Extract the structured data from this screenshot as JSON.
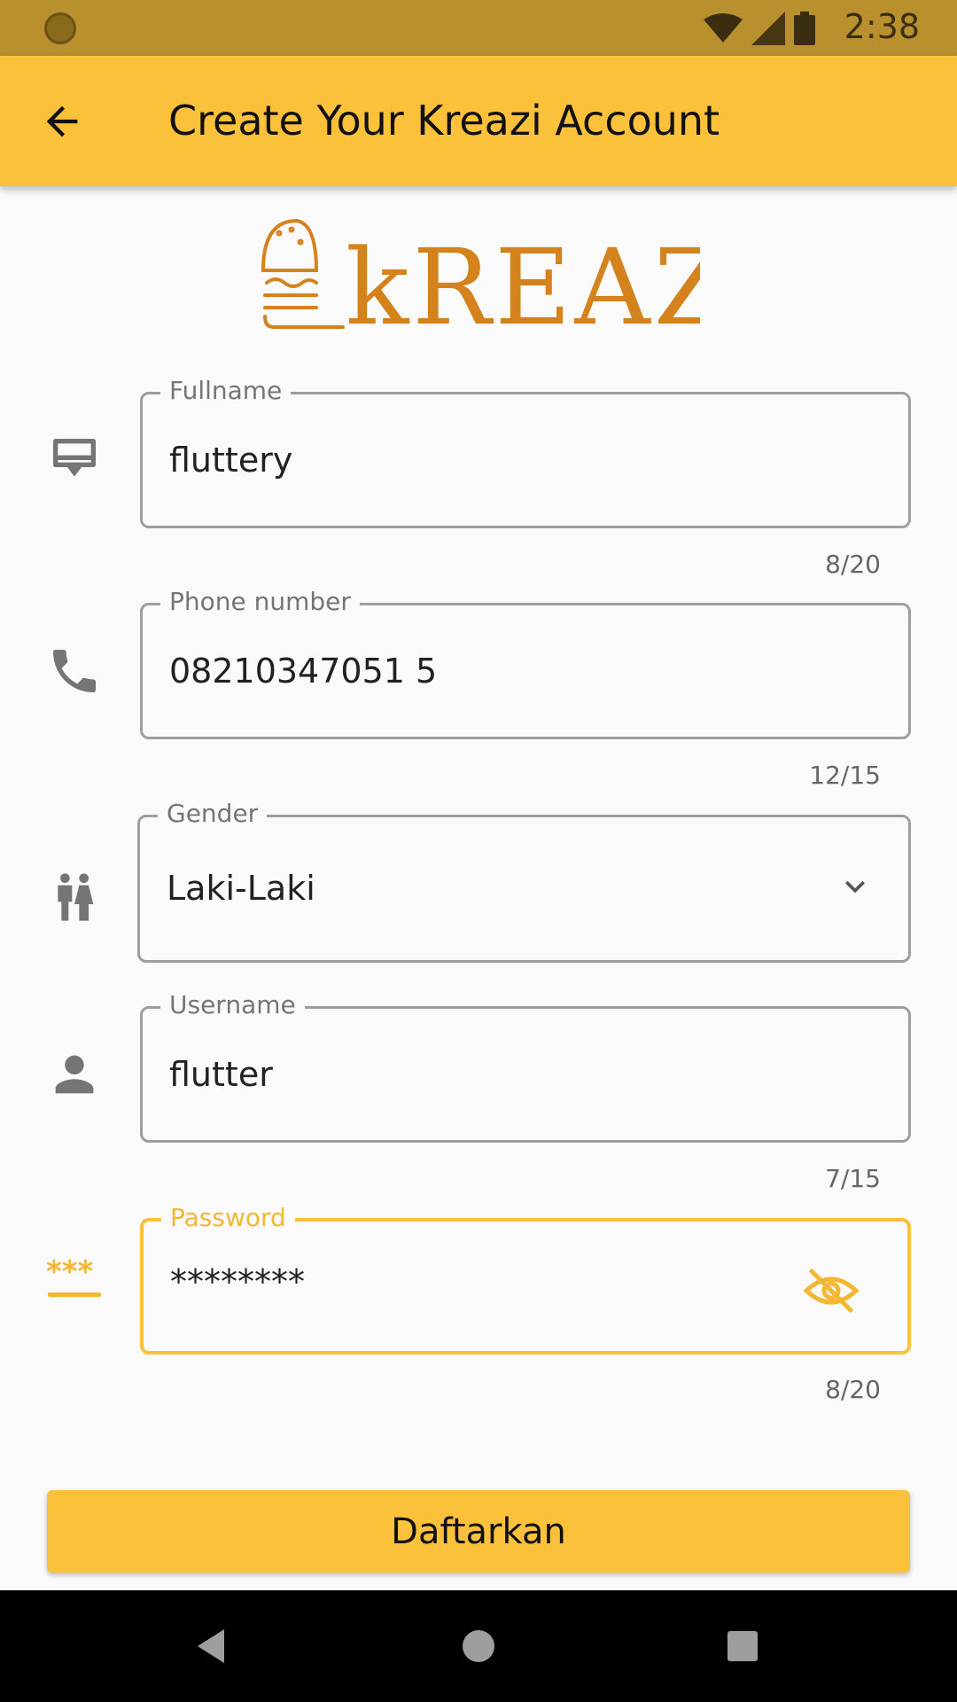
{
  "status_bar": {
    "time": "2:38"
  },
  "app_bar": {
    "title": "Create Your Kreazi Account"
  },
  "logo": {
    "text": "kREAZI",
    "color": "#d4821c"
  },
  "form": {
    "fullname": {
      "label": "Fullname",
      "value": "fluttery",
      "counter": "8/20",
      "icon": "badge-icon"
    },
    "phone": {
      "label": "Phone number",
      "value": "08210347051 5",
      "counter": "12/15",
      "icon": "phone-icon"
    },
    "gender": {
      "label": "Gender",
      "value": "Laki-Laki",
      "icon": "people-icon"
    },
    "username": {
      "label": "Username",
      "value": "flutter",
      "counter": "7/15",
      "icon": "person-icon"
    },
    "password": {
      "label": "Password",
      "value": "********",
      "counter": "8/20",
      "icon": "password-icon"
    }
  },
  "submit": {
    "label": "Daftarkan"
  },
  "colors": {
    "accent": "#fbc13b",
    "status_bar": "#b8912e",
    "focus_label": "#f4b733"
  }
}
